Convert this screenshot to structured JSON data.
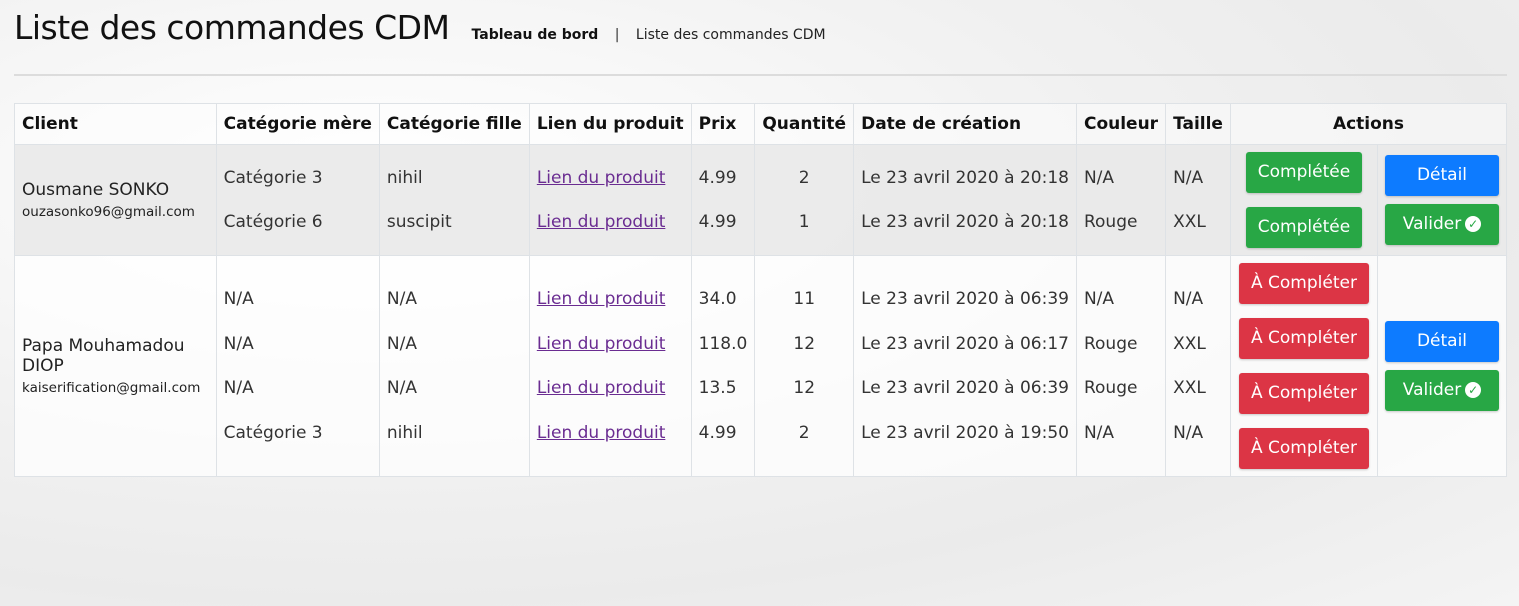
{
  "page": {
    "title": "Liste des commandes CDM",
    "breadcrumb": {
      "home": "Tableau de bord",
      "separator": "|",
      "current": "Liste des commandes CDM"
    }
  },
  "table": {
    "headers": [
      "Client",
      "Catégorie mère",
      "Catégorie fille",
      "Lien du produit",
      "Prix",
      "Quantité",
      "Date de création",
      "Couleur",
      "Taille",
      "Actions"
    ]
  },
  "orders": [
    {
      "client_name": "Ousmane SONKO",
      "client_email": "ouzasonko96@gmail.com",
      "items": [
        {
          "mere": "Catégorie 3",
          "fille": "nihil",
          "lien": "Lien du produit",
          "prix": "4.99",
          "qte": "2",
          "date": "Le 23 avril 2020 à 20:18",
          "couleur": "N/A",
          "taille": "N/A",
          "status": "Complétée"
        },
        {
          "mere": "Catégorie 6",
          "fille": "suscipit",
          "lien": "Lien du produit",
          "prix": "4.99",
          "qte": "1",
          "date": "Le 23 avril 2020 à 20:18",
          "couleur": "Rouge",
          "taille": "XXL",
          "status": "Complétée"
        }
      ],
      "detail_label": "Détail",
      "valider_label": "Valider"
    },
    {
      "client_name": "Papa Mouhamadou DIOP",
      "client_email": "kaiserification@gmail.com",
      "items": [
        {
          "mere": "N/A",
          "fille": "N/A",
          "lien": "Lien du produit",
          "prix": "34.0",
          "qte": "11",
          "date": "Le 23 avril 2020 à 06:39",
          "couleur": "N/A",
          "taille": "N/A",
          "status": "À Compléter"
        },
        {
          "mere": "N/A",
          "fille": "N/A",
          "lien": "Lien du produit",
          "prix": "118.0",
          "qte": "12",
          "date": "Le 23 avril 2020 à 06:17",
          "couleur": "Rouge",
          "taille": "XXL",
          "status": "À Compléter"
        },
        {
          "mere": "N/A",
          "fille": "N/A",
          "lien": "Lien du produit",
          "prix": "13.5",
          "qte": "12",
          "date": "Le 23 avril 2020 à 06:39",
          "couleur": "Rouge",
          "taille": "XXL",
          "status": "À Compléter"
        },
        {
          "mere": "Catégorie 3",
          "fille": "nihil",
          "lien": "Lien du produit",
          "prix": "4.99",
          "qte": "2",
          "date": "Le 23 avril 2020 à 19:50",
          "couleur": "N/A",
          "taille": "N/A",
          "status": "À Compléter"
        }
      ],
      "detail_label": "Détail",
      "valider_label": "Valider"
    }
  ],
  "colors": {
    "completed": "#28a745",
    "to_complete": "#dc3545",
    "detail": "#0d7bff",
    "link": "#6a2c91"
  },
  "icons": {
    "valider": "check-circle-icon"
  }
}
